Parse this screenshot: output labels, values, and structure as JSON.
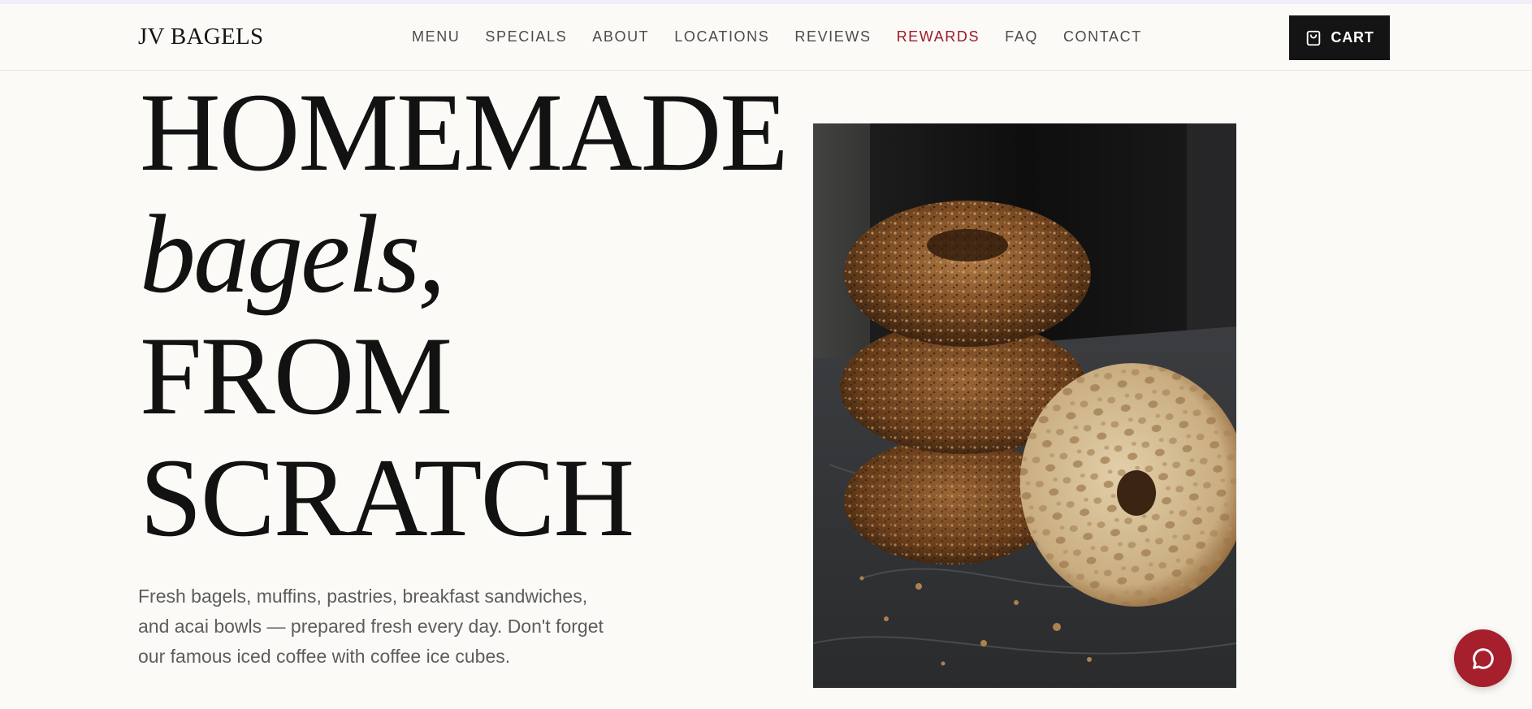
{
  "header": {
    "logo": "JV BAGELS",
    "nav": [
      {
        "label": "MENU",
        "active": false
      },
      {
        "label": "SPECIALS",
        "active": false
      },
      {
        "label": "ABOUT",
        "active": false
      },
      {
        "label": "LOCATIONS",
        "active": false
      },
      {
        "label": "REVIEWS",
        "active": false
      },
      {
        "label": "REWARDS",
        "active": true
      },
      {
        "label": "FAQ",
        "active": false
      },
      {
        "label": "CONTACT",
        "active": false
      }
    ],
    "cart_label": "CART",
    "cart_icon": "shopping-bag-icon"
  },
  "hero": {
    "line1": "HOMEMADE",
    "line2": "bagels,",
    "line3": "FROM",
    "line4": "SCRATCH",
    "description": "Fresh bagels, muffins, pastries, breakfast sandwiches, and acai bowls — prepared fresh every day. Don't forget our famous iced coffee with coffee ice cubes."
  },
  "chat": {
    "icon": "chat-bubble-icon"
  },
  "colors": {
    "background": "#fbfaf7",
    "accent": "#9b1c28",
    "chat": "#a51f2c",
    "dark": "#141414"
  }
}
